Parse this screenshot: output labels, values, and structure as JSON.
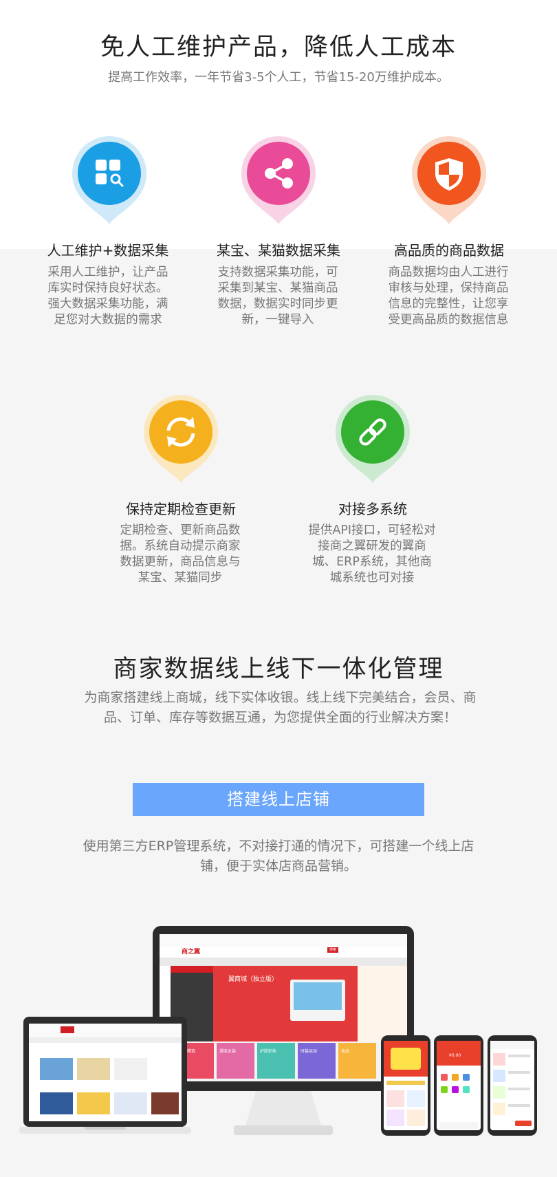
{
  "section1": {
    "title": "免人工维护产品，降低人工成本",
    "subtitle": "提高工作效率，一年节省3-5个人工，节省15-20万维护成本。"
  },
  "features": [
    {
      "icon": "apps-search-icon",
      "color": "#1a9fe5",
      "title": "人工维护+数据采集",
      "desc": "采用人工维护，让产品库实时保持良好状态。强大数据采集功能，满足您对大数据的需求"
    },
    {
      "icon": "share-icon",
      "color": "#ea4b98",
      "title": "某宝、某猫数据采集",
      "desc": "支持数据采集功能，可采集到某宝、某猫商品数据，数据实时同步更新，一键导入"
    },
    {
      "icon": "shield-icon",
      "color": "#f0561d",
      "title": "高品质的商品数据",
      "desc": "商品数据均由人工进行审核与处理，保持商品信息的完整性，让您享受更高品质的数据信息"
    },
    {
      "icon": "refresh-icon",
      "color": "#f5b01e",
      "title": "保持定期检查更新",
      "desc": "定期检查、更新商品数据。系统自动提示商家数据更新，商品信息与某宝、某猫同步"
    },
    {
      "icon": "link-icon",
      "color": "#34b033",
      "title": "对接多系统",
      "desc": "提供API接口，可轻松对接商之翼研发的翼商城、ERP系统，其他商城系统也可对接"
    }
  ],
  "section2": {
    "title": "商家数据线上线下一体化管理",
    "desc": "为商家搭建线上商城，线下实体收银。线上线下完美结合，会员、商品、订单、库存等数据互通，为您提供全面的行业解决方案！",
    "button": "搭建线上店铺",
    "note": "使用第三方ERP管理系统，不对接打通的情况下，可搭建一个线上店铺，便于实体店商品营销。"
  },
  "mockup": {
    "desktop_banner": "翼商城（独立版）",
    "desktop_logo": "商之翼",
    "search_button": "搜索",
    "categories": [
      "品牌精选",
      "潮流女装",
      "护肤彩妆",
      "时装运动",
      "食品"
    ],
    "phone_price": "¥0.00"
  }
}
